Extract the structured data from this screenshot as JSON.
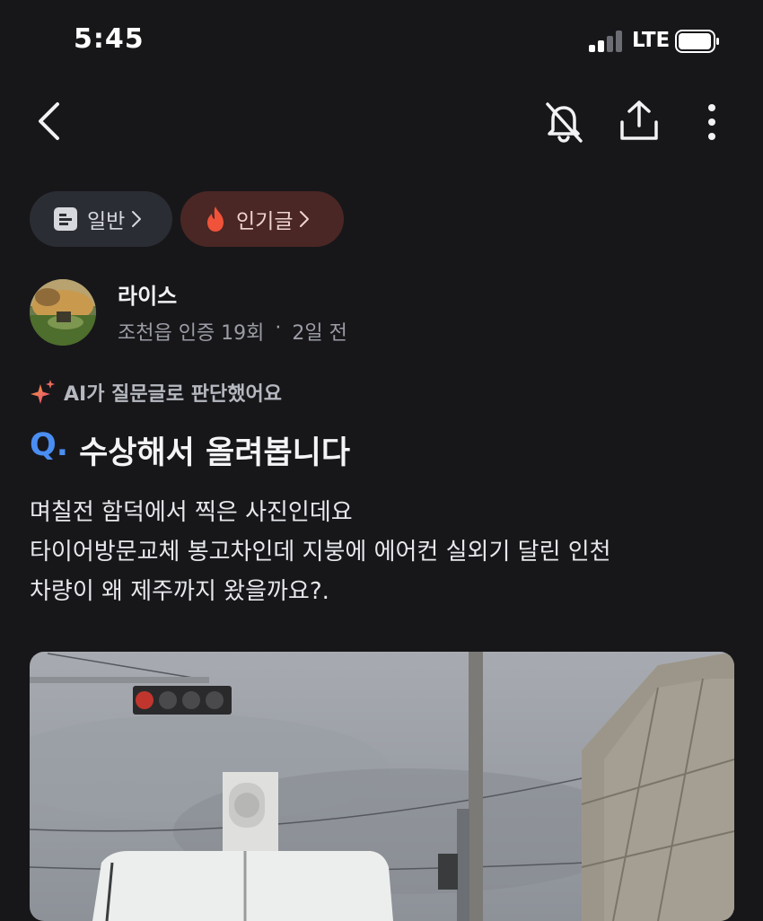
{
  "status_bar": {
    "time": "5:45",
    "network": "LTE",
    "signal_bars_active": 2,
    "signal_bars_total": 4,
    "battery_level": 0.9
  },
  "header": {
    "back_icon": "chevron-left-icon",
    "mute_icon": "bell-off-icon",
    "share_icon": "share-upload-icon",
    "more_icon": "more-vertical-icon"
  },
  "chips": {
    "general": {
      "label": "일반",
      "icon": "board-icon"
    },
    "popular": {
      "label": "인기글",
      "icon": "fire-icon",
      "icon_color": "#f0533a"
    }
  },
  "author": {
    "name": "라이스",
    "location_verify": "조천읍 인증 19회",
    "separator": "·",
    "time_ago": "2일 전"
  },
  "ai_notice": {
    "text": "AI가 질문글로 판단했어요",
    "icon": "sparkle-icon"
  },
  "post": {
    "q_mark": "Q.",
    "title": "수상해서 올려봅니다",
    "body_lines": [
      "며칠전 함덕에서 찍은 사진인데요",
      "타이어방문교체 봉고차인데 지붕에 에어컨 실외기 달린 인천",
      "차량이 왜 제주까지 왔을까요?."
    ]
  },
  "colors": {
    "background": "#17171a",
    "accent_blue": "#4a8ef2",
    "popular_chip_bg": "#4a2724",
    "general_chip_bg": "#2b2d34"
  }
}
